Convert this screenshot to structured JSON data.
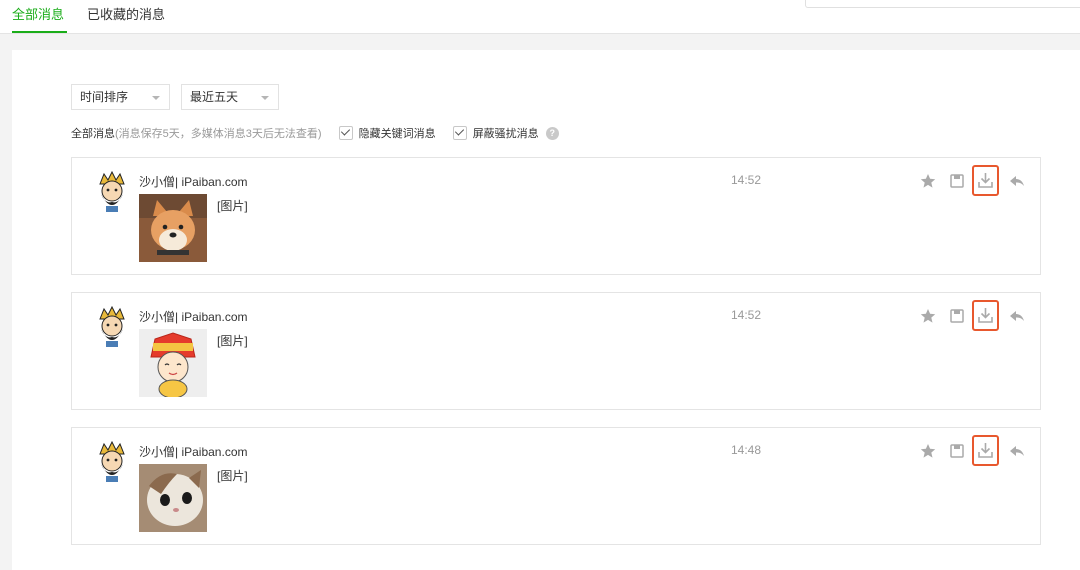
{
  "tabs": [
    {
      "label": "全部消息",
      "active": true
    },
    {
      "label": "已收藏的消息",
      "active": false
    }
  ],
  "filters": {
    "sort": {
      "selected": "时间排序"
    },
    "range": {
      "selected": "最近五天"
    },
    "title": "全部消息",
    "note": "(消息保存5天，多媒体消息3天后无法查看)",
    "hide_keyword": {
      "label": "隐藏关键词消息",
      "checked": true
    },
    "block_spam": {
      "label": "屏蔽骚扰消息",
      "checked": true
    },
    "help_glyph": "?"
  },
  "messages": [
    {
      "sender": "沙小僧| iPaiban.com",
      "content": "[图片]",
      "time": "14:52",
      "thumb": "shiba-dog"
    },
    {
      "sender": "沙小僧| iPaiban.com",
      "content": "[图片]",
      "time": "14:52",
      "thumb": "cartoon-character"
    },
    {
      "sender": "沙小僧| iPaiban.com",
      "content": "[图片]",
      "time": "14:48",
      "thumb": "cat"
    }
  ],
  "actions": [
    "star-icon",
    "save-icon",
    "download-icon",
    "reply-icon"
  ],
  "colors": {
    "accent": "#1aad19",
    "highlight": "#e8582e"
  }
}
